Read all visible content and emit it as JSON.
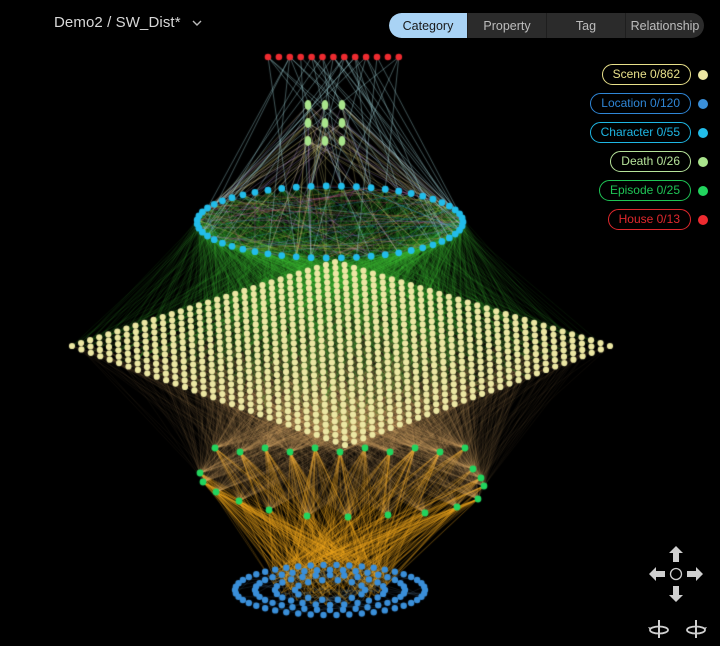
{
  "header": {
    "title": "Demo2 / SW_Dist*",
    "dropdown_icon": "chevron-down-icon"
  },
  "tabs": [
    {
      "label": "Category",
      "active": true
    },
    {
      "label": "Property",
      "active": false
    },
    {
      "label": "Tag",
      "active": false
    },
    {
      "label": "Relationship",
      "active": false
    }
  ],
  "legend": [
    {
      "label": "Scene 0/862",
      "name": "Scene",
      "color": "#e8e08a",
      "dot": "#ece7a3"
    },
    {
      "label": "Location 0/120",
      "name": "Location",
      "color": "#2f86d6",
      "dot": "#3a8fd9"
    },
    {
      "label": "Character 0/55",
      "name": "Character",
      "color": "#1eb6e3",
      "dot": "#22bdea"
    },
    {
      "label": "Death 0/26",
      "name": "Death",
      "color": "#b6e39a",
      "dot": "#a9e48c"
    },
    {
      "label": "Episode 0/25",
      "name": "Episode",
      "color": "#1fc455",
      "dot": "#22d45e"
    },
    {
      "label": "House 0/13",
      "name": "House",
      "color": "#e0282d",
      "dot": "#ee2b30"
    }
  ],
  "graph": {
    "edge_colors": {
      "scene_episode": "#f5b57a",
      "episode_location": "#f2a81c",
      "scene_character": "#3fbf3a",
      "house_links": "#a9dfe6",
      "death_links": "#d8d07a",
      "character_ring": "#c06ad0"
    }
  },
  "navigation": {
    "pan_up": "arrow-up-icon",
    "pan_down": "arrow-down-icon",
    "pan_left": "arrow-left-icon",
    "pan_right": "arrow-right-icon",
    "center": "center-circle-icon",
    "rotate_left": "rotate-left-icon",
    "rotate_right": "rotate-right-icon"
  }
}
